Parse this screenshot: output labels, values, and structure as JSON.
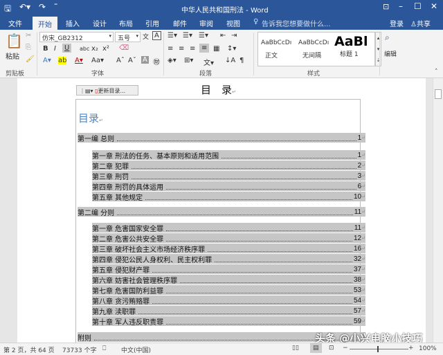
{
  "title": "中华人民共和国刑法 - Word",
  "tabs": [
    "文件",
    "开始",
    "插入",
    "设计",
    "布局",
    "引用",
    "邮件",
    "审阅",
    "视图"
  ],
  "tell_me": "告诉我您想要做什么...",
  "login": "登录",
  "share": "共享",
  "ribbon": {
    "paste": "粘贴",
    "font_name": "仿宋_GB2312",
    "font_size": "五号",
    "styles": [
      {
        "preview": "AaBbCcDı",
        "name": "正文"
      },
      {
        "preview": "AaBbCcDı",
        "name": "无间隔"
      },
      {
        "preview": "AaBl",
        "name": "标题 1"
      }
    ],
    "edit": "编辑",
    "groups": [
      "剪贴板",
      "字体",
      "段落",
      "样式"
    ]
  },
  "doc": {
    "heading": "目　录",
    "toc_title": "目录",
    "update_toc": "更新目录...",
    "entries": [
      {
        "level": 1,
        "text": "第一编 总则",
        "page": "1"
      },
      {
        "level": 2,
        "text": "第一章 刑法的任务、基本原则和适用范围",
        "page": "1"
      },
      {
        "level": 2,
        "text": "第二章 犯罪",
        "page": "2"
      },
      {
        "level": 2,
        "text": "第三章 刑罚",
        "page": "3"
      },
      {
        "level": 2,
        "text": "第四章 刑罚的具体运用",
        "page": "6"
      },
      {
        "level": 2,
        "text": "第五章 其他规定",
        "page": "10"
      },
      {
        "level": 1,
        "text": "第二编 分则",
        "page": "11"
      },
      {
        "level": 2,
        "text": "第一章 危害国家安全罪",
        "page": "11"
      },
      {
        "level": 2,
        "text": "第二章 危害公共安全罪",
        "page": "12"
      },
      {
        "level": 2,
        "text": "第三章 破坏社会主义市场经济秩序罪",
        "page": "16"
      },
      {
        "level": 2,
        "text": "第四章 侵犯公民人身权利、民主权利罪",
        "page": "32"
      },
      {
        "level": 2,
        "text": "第五章 侵犯财产罪",
        "page": "37"
      },
      {
        "level": 2,
        "text": "第六章 妨害社会管理秩序罪",
        "page": "38"
      },
      {
        "level": 2,
        "text": "第七章 危害国防利益罪",
        "page": "53"
      },
      {
        "level": 2,
        "text": "第八章 贪污贿赂罪",
        "page": "54"
      },
      {
        "level": 2,
        "text": "第九章 渎职罪",
        "page": "57"
      },
      {
        "level": 2,
        "text": "第十章 军人违反职责罪",
        "page": "59"
      },
      {
        "level": 1,
        "text": "附则",
        "page": ""
      }
    ]
  },
  "status": {
    "page": "第 2 页，共 64 页",
    "words": "73733 个字",
    "lang": "中文(中国)",
    "zoom": "100%"
  },
  "watermark": "头条 @小兴电脑小技巧"
}
